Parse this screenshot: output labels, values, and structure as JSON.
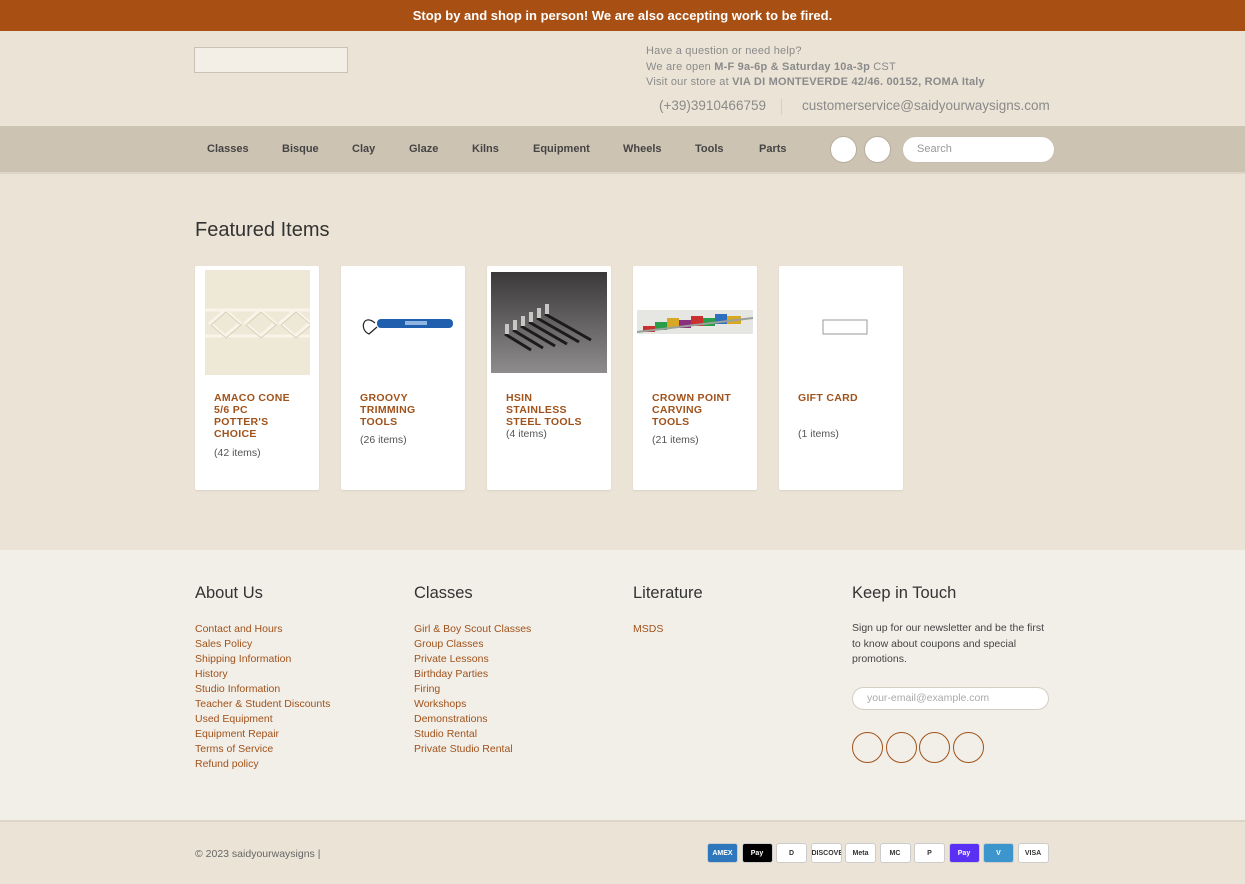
{
  "announcement": "Stop by and shop in person! We are also accepting work to be fired.",
  "header": {
    "contact_line1": "Have a question or need help?",
    "contact_line2_pre": "We are open ",
    "contact_line2_hours": "M-F 9a-6p & Saturday 10a-3p",
    "contact_line2_post": " CST",
    "contact_line3_pre": "Visit our store at ",
    "contact_line3_address": "VIA DI MONTEVERDE 42/46. 00152, ROMA Italy",
    "phone": "(+39)3910466759",
    "email": "customerservice@saidyourwaysigns.com"
  },
  "nav": {
    "items": [
      "Classes",
      "Bisque",
      "Clay",
      "Glaze",
      "Kilns",
      "Equipment",
      "Wheels",
      "Tools",
      "Parts"
    ],
    "search_placeholder": "Search"
  },
  "featured": {
    "title": "Featured Items",
    "cards": [
      {
        "title": "AMACO CONE 5/6 PC POTTER'S CHOICE",
        "count": "(42 items)"
      },
      {
        "title": "GROOVY TRIMMING TOOLS",
        "count": "(26 items)"
      },
      {
        "title": "HSIN STAINLESS STEEL TOOLS",
        "count": "(4 items)"
      },
      {
        "title": "CROWN POINT CARVING TOOLS",
        "count": "(21 items)"
      },
      {
        "title": "GIFT CARD",
        "count": "(1 items)"
      }
    ]
  },
  "footer": {
    "about_title": "About Us",
    "about_links": [
      "Contact and Hours",
      "Sales Policy",
      "Shipping Information",
      "History",
      "Studio Information",
      "Teacher & Student Discounts",
      "Used Equipment",
      "Equipment Repair",
      "Terms of Service",
      "Refund policy"
    ],
    "classes_title": "Classes",
    "classes_links": [
      "Girl & Boy Scout Classes",
      "Group Classes",
      "Private Lessons",
      "Birthday Parties",
      "Firing",
      "Workshops",
      "Demonstrations",
      "Studio Rental",
      "Private Studio Rental"
    ],
    "literature_title": "Literature",
    "literature_links": [
      "MSDS"
    ],
    "keep_title": "Keep in Touch",
    "newsletter_text": "Sign up for our newsletter and be the first to know about coupons and special promotions.",
    "email_placeholder": "your-email@example.com"
  },
  "bottom": {
    "copyright": "© 2023 saidyourwaysigns |",
    "payments": [
      {
        "name": "amex-icon",
        "label": "AMEX",
        "bg": "#2e77bc"
      },
      {
        "name": "apple-pay-icon",
        "label": "Pay",
        "bg": "#000000"
      },
      {
        "name": "diners-club-icon",
        "label": "D",
        "bg": "#ffffff"
      },
      {
        "name": "discover-icon",
        "label": "DISCOVER",
        "bg": "#ffffff"
      },
      {
        "name": "meta-pay-icon",
        "label": "Meta",
        "bg": "#ffffff"
      },
      {
        "name": "mastercard-icon",
        "label": "MC",
        "bg": "#ffffff"
      },
      {
        "name": "paypal-icon",
        "label": "P",
        "bg": "#ffffff"
      },
      {
        "name": "shop-pay-icon",
        "label": "Pay",
        "bg": "#5a31f4"
      },
      {
        "name": "venmo-icon",
        "label": "V",
        "bg": "#3d95ce"
      },
      {
        "name": "visa-icon",
        "label": "VISA",
        "bg": "#ffffff"
      }
    ]
  }
}
